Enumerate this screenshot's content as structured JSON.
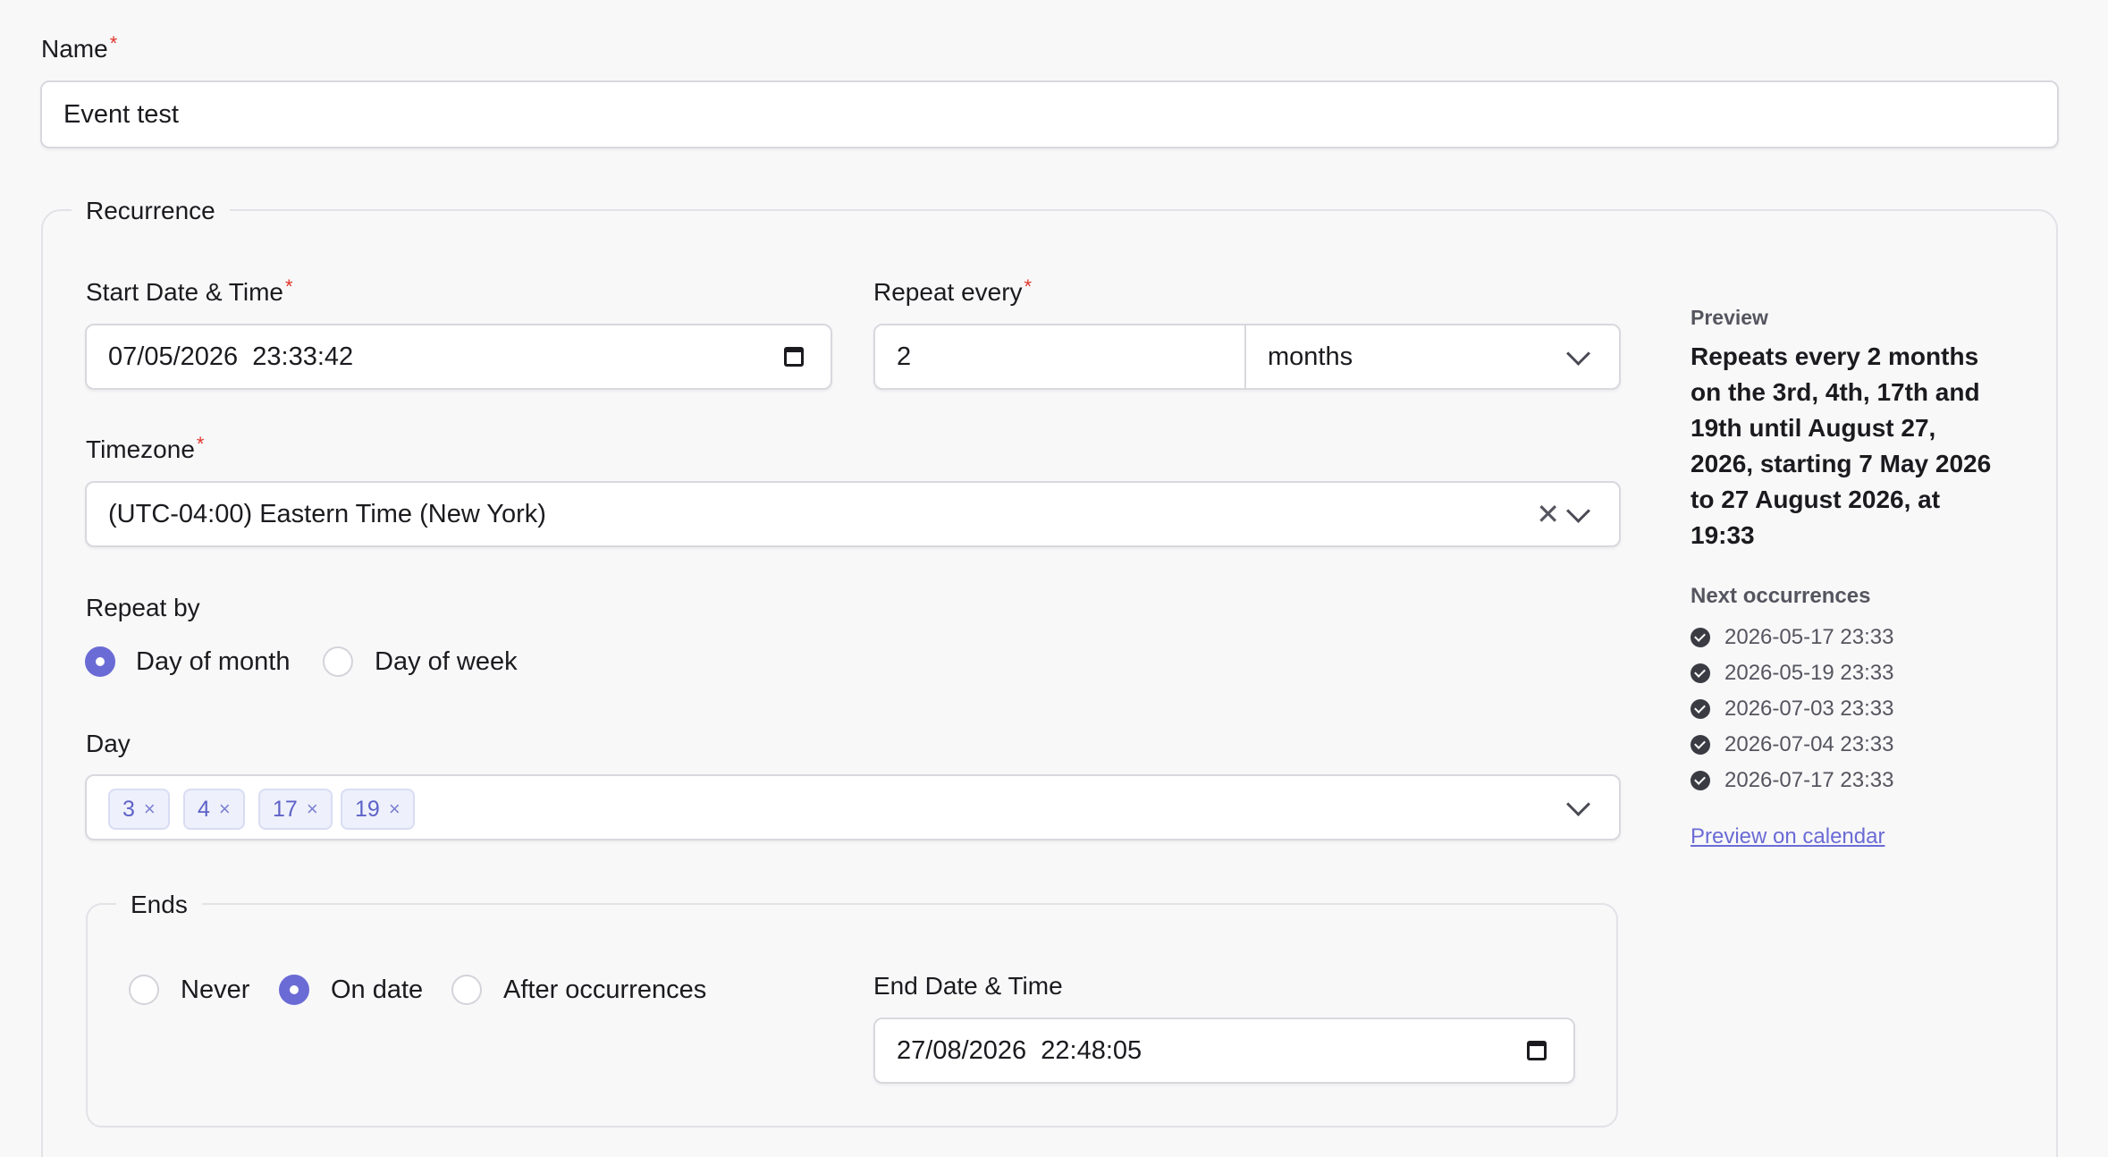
{
  "name": {
    "label": "Name",
    "required_mark": "*",
    "value": "Event test"
  },
  "recurrence": {
    "legend": "Recurrence",
    "start": {
      "label": "Start Date & Time",
      "required_mark": "*",
      "value": "07/05/2026  23:33:42",
      "icon": "calendar-icon"
    },
    "repeat_every": {
      "label": "Repeat every",
      "required_mark": "*",
      "value": "2",
      "unit": "months",
      "icon": "chevron-down-icon"
    },
    "timezone": {
      "label": "Timezone",
      "required_mark": "*",
      "value": "(UTC-04:00) Eastern Time (New York)",
      "clear_icon": "close-icon",
      "icon": "chevron-down-icon"
    },
    "repeat_by": {
      "label": "Repeat by",
      "options": [
        "Day of month",
        "Day of week"
      ],
      "selected": "Day of month"
    },
    "day": {
      "label": "Day",
      "chips": [
        "3",
        "4",
        "17",
        "19"
      ],
      "remove_glyph": "×",
      "icon": "chevron-down-icon"
    },
    "ends": {
      "legend": "Ends",
      "options": [
        "Never",
        "On date",
        "After occurrences"
      ],
      "selected": "On date",
      "end_label": "End Date & Time",
      "end_value": "27/08/2026  22:48:05",
      "icon": "calendar-icon"
    }
  },
  "preview": {
    "title": "Preview",
    "text": "Repeats every 2 months on the 3rd, 4th, 17th and 19th until August 27, 2026, starting 7 May 2026 to 27 August 2026, at 19:33",
    "next_title": "Next occurrences",
    "occurrences": [
      "2026-05-17 23:33",
      "2026-05-19 23:33",
      "2026-07-03 23:33",
      "2026-07-04 23:33",
      "2026-07-17 23:33"
    ],
    "link": "Preview on calendar"
  },
  "colors": {
    "accent": "#6b6bd6",
    "required": "#e0362b",
    "border": "#d8d8de",
    "background": "#f8f8f9"
  }
}
